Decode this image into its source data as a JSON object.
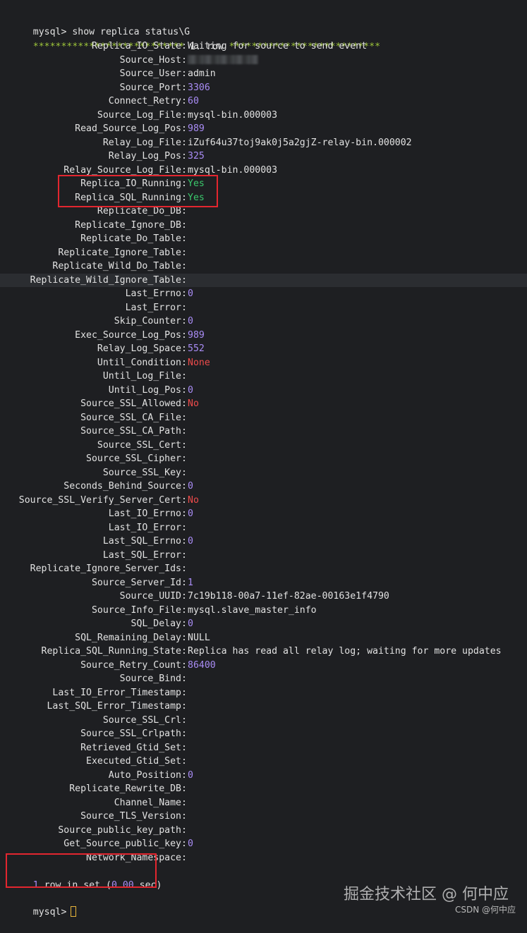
{
  "prompt_command": "mysql> show replica status\\G",
  "row_header": {
    "left_stars": "***************************",
    "label": " 1. row ",
    "right_stars": "***************************"
  },
  "fields": [
    {
      "key": "Replica_IO_State",
      "value": "Waiting for source to send event",
      "color": "text"
    },
    {
      "key": "Source_Host",
      "value": "",
      "color": "text",
      "obscured": true
    },
    {
      "key": "Source_User",
      "value": "admin",
      "color": "text"
    },
    {
      "key": "Source_Port",
      "value": "3306",
      "color": "num"
    },
    {
      "key": "Connect_Retry",
      "value": "60",
      "color": "num"
    },
    {
      "key": "Source_Log_File",
      "value": "mysql-bin.000003",
      "color": "text"
    },
    {
      "key": "Read_Source_Log_Pos",
      "value": "989",
      "color": "num"
    },
    {
      "key": "Relay_Log_File",
      "value": "iZuf64u37toj9ak0j5a2gjZ-relay-bin.000002",
      "color": "text"
    },
    {
      "key": "Relay_Log_Pos",
      "value": "325",
      "color": "num"
    },
    {
      "key": "Relay_Source_Log_File",
      "value": "mysql-bin.000003",
      "color": "text"
    },
    {
      "key": "Replica_IO_Running",
      "value": "Yes",
      "color": "yes"
    },
    {
      "key": "Replica_SQL_Running",
      "value": "Yes",
      "color": "yes"
    },
    {
      "key": "Replicate_Do_DB",
      "value": "",
      "color": "text"
    },
    {
      "key": "Replicate_Ignore_DB",
      "value": "",
      "color": "text"
    },
    {
      "key": "Replicate_Do_Table",
      "value": "",
      "color": "text"
    },
    {
      "key": "Replicate_Ignore_Table",
      "value": "",
      "color": "text"
    },
    {
      "key": "Replicate_Wild_Do_Table",
      "value": "",
      "color": "text"
    },
    {
      "key": "Replicate_Wild_Ignore_Table",
      "value": "",
      "color": "text",
      "highlight": true
    },
    {
      "key": "Last_Errno",
      "value": "0",
      "color": "num"
    },
    {
      "key": "Last_Error",
      "value": "",
      "color": "text"
    },
    {
      "key": "Skip_Counter",
      "value": "0",
      "color": "num"
    },
    {
      "key": "Exec_Source_Log_Pos",
      "value": "989",
      "color": "num"
    },
    {
      "key": "Relay_Log_Space",
      "value": "552",
      "color": "num"
    },
    {
      "key": "Until_Condition",
      "value": "None",
      "color": "red"
    },
    {
      "key": "Until_Log_File",
      "value": "",
      "color": "text"
    },
    {
      "key": "Until_Log_Pos",
      "value": "0",
      "color": "num"
    },
    {
      "key": "Source_SSL_Allowed",
      "value": "No",
      "color": "red"
    },
    {
      "key": "Source_SSL_CA_File",
      "value": "",
      "color": "text"
    },
    {
      "key": "Source_SSL_CA_Path",
      "value": "",
      "color": "text"
    },
    {
      "key": "Source_SSL_Cert",
      "value": "",
      "color": "text"
    },
    {
      "key": "Source_SSL_Cipher",
      "value": "",
      "color": "text"
    },
    {
      "key": "Source_SSL_Key",
      "value": "",
      "color": "text"
    },
    {
      "key": "Seconds_Behind_Source",
      "value": "0",
      "color": "num"
    },
    {
      "key": "Source_SSL_Verify_Server_Cert",
      "value": "No",
      "color": "red"
    },
    {
      "key": "Last_IO_Errno",
      "value": "0",
      "color": "num"
    },
    {
      "key": "Last_IO_Error",
      "value": "",
      "color": "text"
    },
    {
      "key": "Last_SQL_Errno",
      "value": "0",
      "color": "num"
    },
    {
      "key": "Last_SQL_Error",
      "value": "",
      "color": "text"
    },
    {
      "key": "Replicate_Ignore_Server_Ids",
      "value": "",
      "color": "text"
    },
    {
      "key": "Source_Server_Id",
      "value": "1",
      "color": "num"
    },
    {
      "key": "Source_UUID",
      "value": "7c19b118-00a7-11ef-82ae-00163e1f4790",
      "color": "text"
    },
    {
      "key": "Source_Info_File",
      "value": "mysql.slave_master_info",
      "color": "text"
    },
    {
      "key": "SQL_Delay",
      "value": "0",
      "color": "num"
    },
    {
      "key": "SQL_Remaining_Delay",
      "value": "NULL",
      "color": "text"
    },
    {
      "key": "Replica_SQL_Running_State",
      "value": "Replica has read all relay log; waiting for more updates",
      "color": "text"
    },
    {
      "key": "Source_Retry_Count",
      "value": "86400",
      "color": "num"
    },
    {
      "key": "Source_Bind",
      "value": "",
      "color": "text"
    },
    {
      "key": "Last_IO_Error_Timestamp",
      "value": "",
      "color": "text"
    },
    {
      "key": "Last_SQL_Error_Timestamp",
      "value": "",
      "color": "text"
    },
    {
      "key": "Source_SSL_Crl",
      "value": "",
      "color": "text"
    },
    {
      "key": "Source_SSL_Crlpath",
      "value": "",
      "color": "text"
    },
    {
      "key": "Retrieved_Gtid_Set",
      "value": "",
      "color": "text"
    },
    {
      "key": "Executed_Gtid_Set",
      "value": "",
      "color": "text"
    },
    {
      "key": "Auto_Position",
      "value": "0",
      "color": "num"
    },
    {
      "key": "Replicate_Rewrite_DB",
      "value": "",
      "color": "text"
    },
    {
      "key": "Channel_Name",
      "value": "",
      "color": "text"
    },
    {
      "key": "Source_TLS_Version",
      "value": "",
      "color": "text"
    },
    {
      "key": "Source_public_key_path",
      "value": "",
      "color": "text"
    },
    {
      "key": "Get_Source_public_key",
      "value": "0",
      "color": "num"
    },
    {
      "key": "Network_Namespace",
      "value": "",
      "color": "text"
    }
  ],
  "summary": {
    "count": "1",
    "text": " row in set (",
    "time": "0.00",
    "suffix": " sec)"
  },
  "final_prompt": "mysql>",
  "watermark": "掘金技术社区 @ 何中应",
  "credit": "CSDN @何中应",
  "colors": {
    "background": "#1e1f22",
    "text": "#e2e2e2",
    "stars": "#9dc43a",
    "number": "#a98cf5",
    "yes": "#3ac76b",
    "red": "#ee4b4b",
    "annotation_box": "#e3262f",
    "cursor": "#e8b53a"
  }
}
